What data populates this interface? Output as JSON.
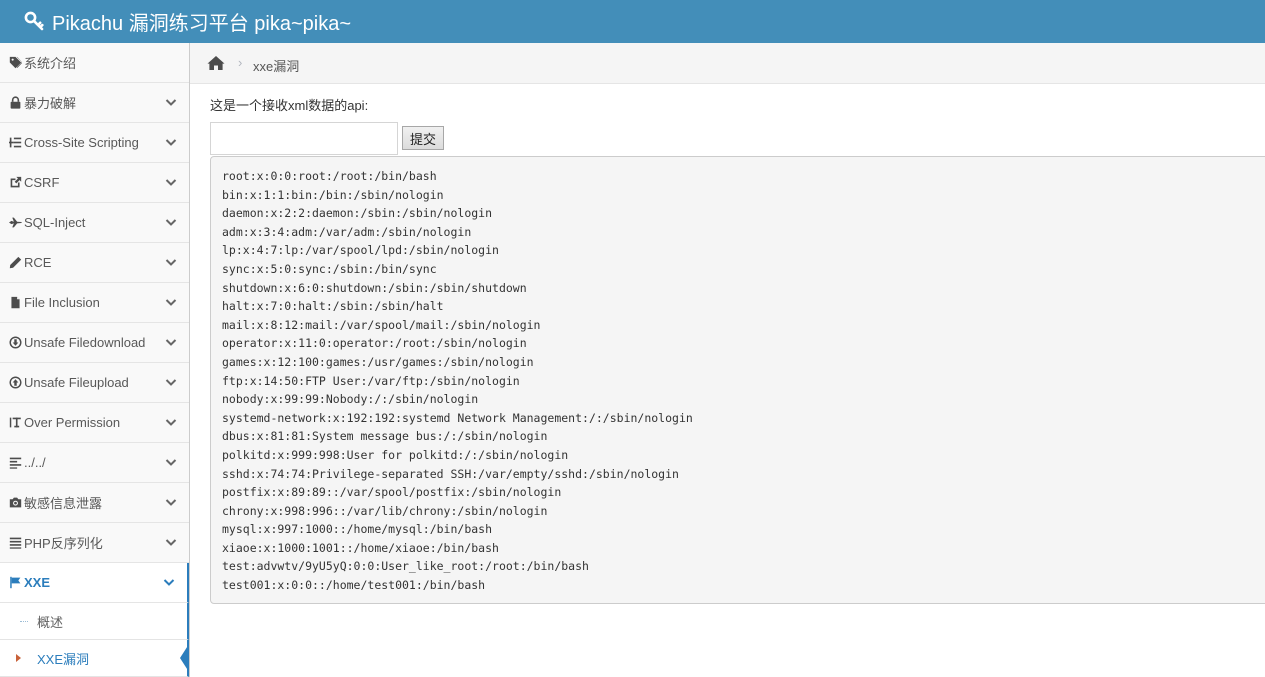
{
  "header": {
    "title": "Pikachu 漏洞练习平台 pika~pika~"
  },
  "sidebar": {
    "items": [
      {
        "label": "系统介绍",
        "icon": "tag-icon",
        "has_chevron": false
      },
      {
        "label": "暴力破解",
        "icon": "lock-icon",
        "has_chevron": true
      },
      {
        "label": "Cross-Site Scripting",
        "icon": "list-tree-icon",
        "has_chevron": true
      },
      {
        "label": "CSRF",
        "icon": "external-link-icon",
        "has_chevron": true
      },
      {
        "label": "SQL-Inject",
        "icon": "fighter-jet-icon",
        "has_chevron": true
      },
      {
        "label": "RCE",
        "icon": "pencil-icon",
        "has_chevron": true
      },
      {
        "label": "File Inclusion",
        "icon": "file-icon",
        "has_chevron": true
      },
      {
        "label": "Unsafe Filedownload",
        "icon": "download-circle-icon",
        "has_chevron": true
      },
      {
        "label": "Unsafe Fileupload",
        "icon": "upload-circle-icon",
        "has_chevron": true
      },
      {
        "label": "Over Permission",
        "icon": "text-height-icon",
        "has_chevron": true
      },
      {
        "label": "../../",
        "icon": "align-left-icon",
        "has_chevron": true
      },
      {
        "label": "敏感信息泄露",
        "icon": "camera-icon",
        "has_chevron": true
      },
      {
        "label": "PHP反序列化",
        "icon": "align-justify-icon",
        "has_chevron": true
      },
      {
        "label": "XXE",
        "icon": "flag-icon",
        "has_chevron": true,
        "active": true
      }
    ],
    "subitems": [
      {
        "label": "概述"
      },
      {
        "label": "XXE漏洞",
        "current": true
      }
    ]
  },
  "breadcrumb": {
    "separator": "›",
    "current": "xxe漏洞"
  },
  "main": {
    "intro": "这是一个接收xml数据的api:",
    "input_value": "",
    "submit_label": "提交",
    "output_lines": [
      "root:x:0:0:root:/root:/bin/bash",
      "bin:x:1:1:bin:/bin:/sbin/nologin",
      "daemon:x:2:2:daemon:/sbin:/sbin/nologin",
      "adm:x:3:4:adm:/var/adm:/sbin/nologin",
      "lp:x:4:7:lp:/var/spool/lpd:/sbin/nologin",
      "sync:x:5:0:sync:/sbin:/bin/sync",
      "shutdown:x:6:0:shutdown:/sbin:/sbin/shutdown",
      "halt:x:7:0:halt:/sbin:/sbin/halt",
      "mail:x:8:12:mail:/var/spool/mail:/sbin/nologin",
      "operator:x:11:0:operator:/root:/sbin/nologin",
      "games:x:12:100:games:/usr/games:/sbin/nologin",
      "ftp:x:14:50:FTP User:/var/ftp:/sbin/nologin",
      "nobody:x:99:99:Nobody:/:/sbin/nologin",
      "systemd-network:x:192:192:systemd Network Management:/:/sbin/nologin",
      "dbus:x:81:81:System message bus:/:/sbin/nologin",
      "polkitd:x:999:998:User for polkitd:/:/sbin/nologin",
      "sshd:x:74:74:Privilege-separated SSH:/var/empty/sshd:/sbin/nologin",
      "postfix:x:89:89::/var/spool/postfix:/sbin/nologin",
      "chrony:x:998:996::/var/lib/chrony:/sbin/nologin",
      "mysql:x:997:1000::/home/mysql:/bin/bash",
      "xiaoe:x:1000:1001::/home/xiaoe:/bin/bash",
      "test:advwtv/9yU5yQ:0:0:User_like_root:/root:/bin/bash",
      "test001:x:0:0::/home/test001:/bin/bash"
    ]
  },
  "colors": {
    "header_bg": "#438eb9",
    "active": "#2b7dbc",
    "caret": "#c86139"
  }
}
